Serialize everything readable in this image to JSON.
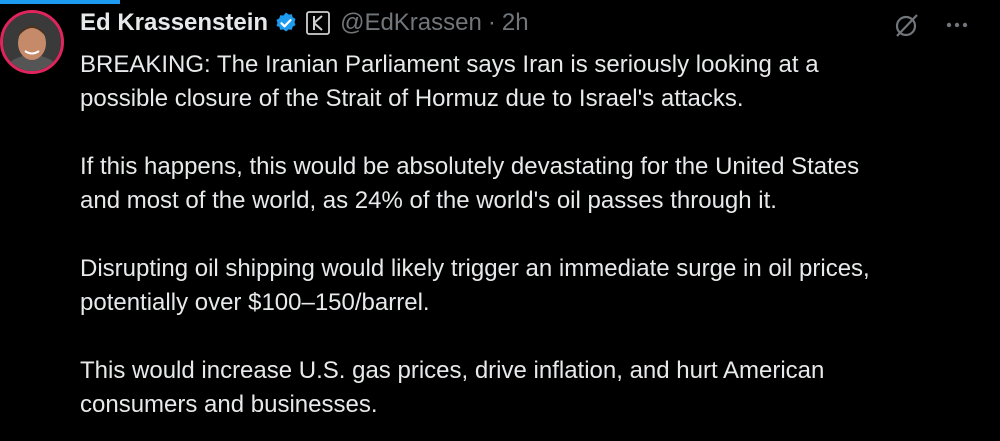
{
  "tweet": {
    "author": {
      "name": "Ed Krassenstein",
      "handle": "@EdKrassen",
      "verified": true
    },
    "separator": "·",
    "time": "2h",
    "paragraphs": [
      "BREAKING: The Iranian Parliament says Iran is seriously looking at a",
      "possible closure of the Strait of Hormuz due to Israel's attacks.",
      "If this happens, this would be absolutely devastating for the United States",
      "and most of the world, as 24% of the world's oil passes through it.",
      "Disrupting oil shipping would likely trigger an immediate surge in oil prices,",
      "potentially over $100–150/barrel.",
      "This would increase U.S. gas prices, drive inflation, and hurt American",
      "consumers and businesses."
    ],
    "icons": {
      "verified": "verified-check-icon",
      "affiliate": "k-affiliate-icon",
      "grok": "grok-icon",
      "more": "more-icon"
    }
  },
  "colors": {
    "background": "#000000",
    "text": "#e7e9ea",
    "muted": "#71767b",
    "accent": "#1d9bf0",
    "avatar_ring": "#e0245e"
  }
}
